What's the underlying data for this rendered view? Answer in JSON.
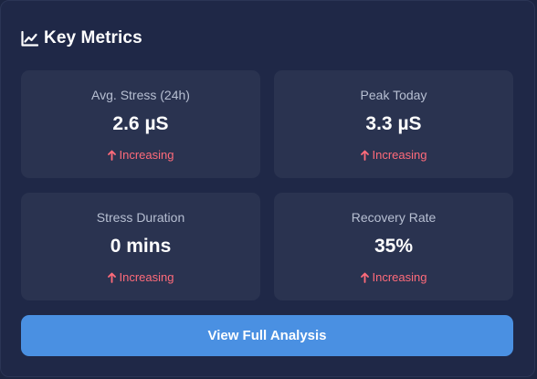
{
  "header": {
    "title": "Key Metrics",
    "icon": "line-chart-icon"
  },
  "metrics": [
    {
      "label": "Avg. Stress (24h)",
      "value": "2.6 µS",
      "trend": "Increasing",
      "trend_icon": "arrow-up-icon"
    },
    {
      "label": "Peak Today",
      "value": "3.3 µS",
      "trend": "Increasing",
      "trend_icon": "arrow-up-icon"
    },
    {
      "label": "Stress Duration",
      "value": "0 mins",
      "trend": "Increasing",
      "trend_icon": "arrow-up-icon"
    },
    {
      "label": "Recovery Rate",
      "value": "35%",
      "trend": "Increasing",
      "trend_icon": "arrow-up-icon"
    }
  ],
  "action": {
    "label": "View Full Analysis"
  },
  "colors": {
    "background": "#1f2847",
    "tile": "#2a3350",
    "accent": "#4a90e2",
    "trend": "#ff6b7a"
  }
}
